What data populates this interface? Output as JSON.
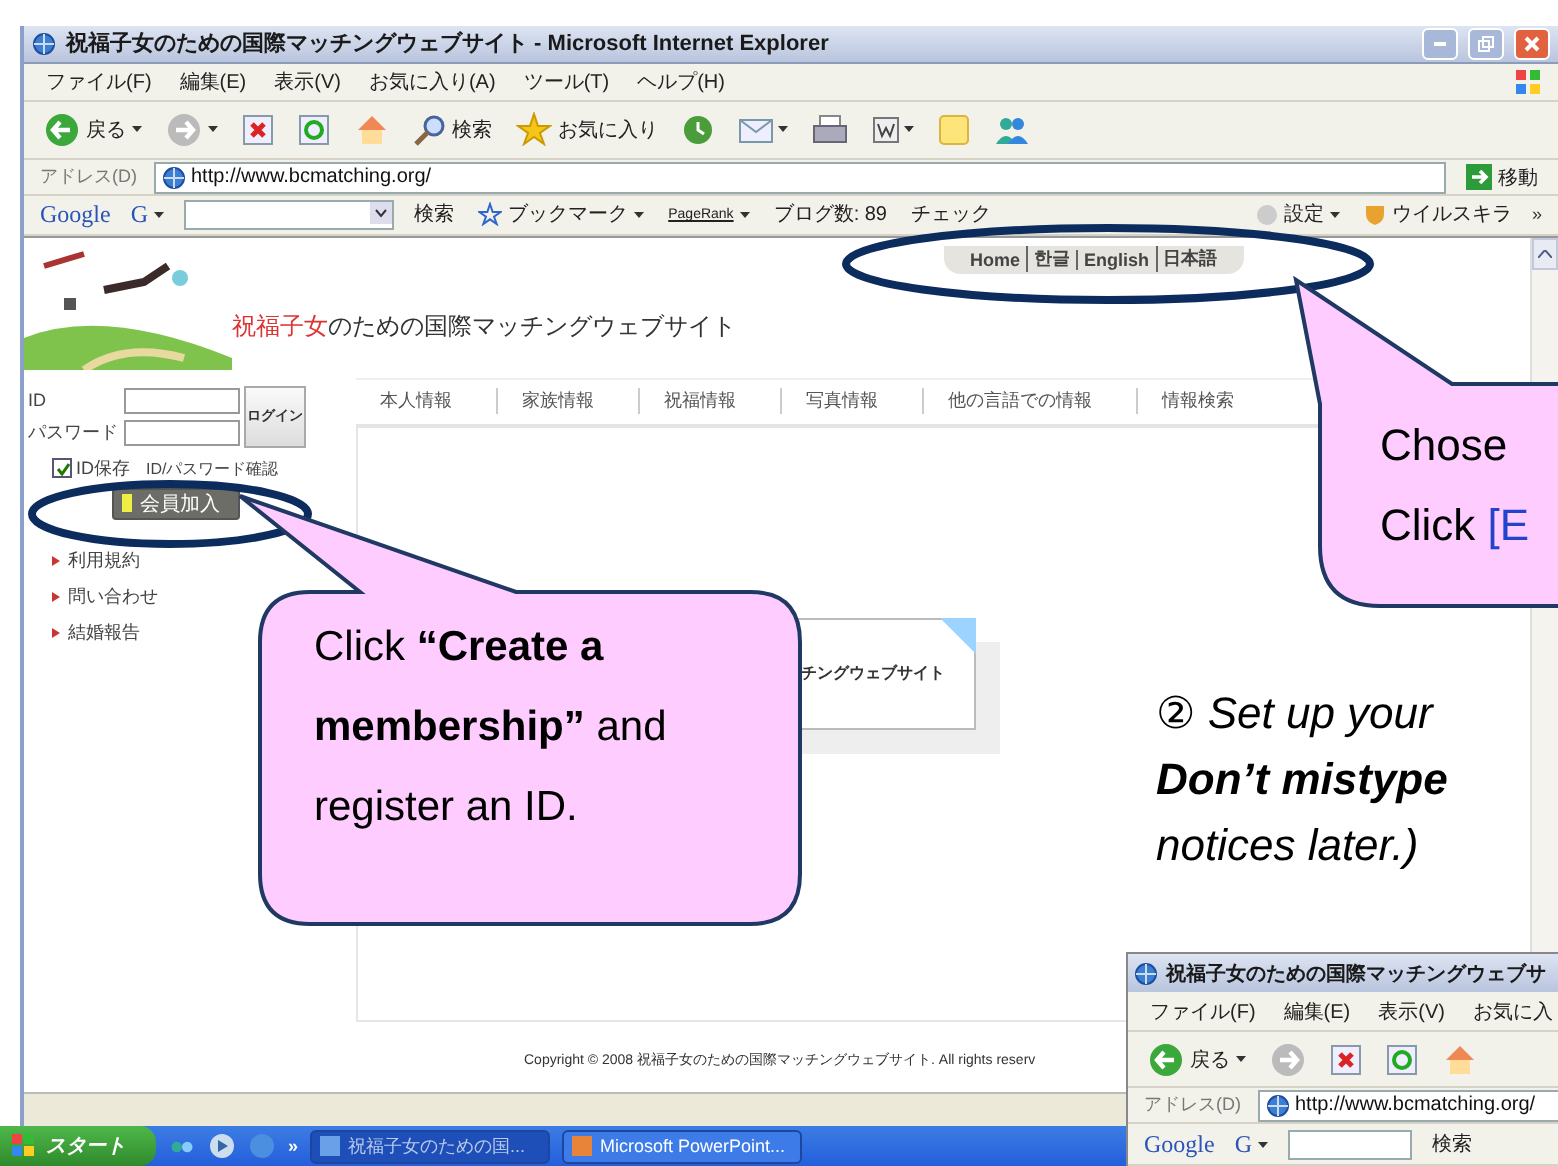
{
  "window": {
    "title": "祝福子女のための国際マッチングウェブサイト - Microsoft Internet Explorer"
  },
  "menu": [
    "ファイル(F)",
    "編集(E)",
    "表示(V)",
    "お気に入り(A)",
    "ツール(T)",
    "ヘルプ(H)"
  ],
  "toolbar": [
    {
      "kind": "back",
      "label": "戻る"
    },
    {
      "kind": "forward"
    },
    {
      "kind": "stop"
    },
    {
      "kind": "refresh"
    },
    {
      "kind": "home"
    },
    {
      "kind": "search",
      "label": "検索"
    },
    {
      "kind": "favorites",
      "label": "お気に入り"
    },
    {
      "kind": "history"
    },
    {
      "kind": "mail"
    },
    {
      "kind": "print"
    },
    {
      "kind": "word"
    },
    {
      "kind": "note"
    },
    {
      "kind": "messenger"
    }
  ],
  "address": {
    "label": "アドレス(D)",
    "url": "http://www.bcmatching.org/",
    "go": "移動"
  },
  "google_bar": {
    "logo": "Google",
    "engine": "G",
    "search": "検索",
    "bookmarks": "ブックマーク",
    "pagerank": "PageRank",
    "blog_count": "ブログ数: 89",
    "check": "チェック",
    "settings": "設定",
    "virus": "ウイルスキラ",
    "more": "»"
  },
  "site": {
    "title_highlight": "祝福子女",
    "title_rest": "のための国際マッチングウェブサイト",
    "lang_links": [
      "Home",
      "한글",
      "English",
      "日本語"
    ],
    "login": {
      "id_label": "ID",
      "password_label": "パスワード",
      "button": "ログイン",
      "remember": {
        "label": "ID保存",
        "checked": true
      },
      "find_link": "ID/パスワード確認",
      "join_button": "会員加入"
    },
    "links": [
      "利用規約",
      "問い合わせ",
      "結婚報告"
    ],
    "nav": [
      "本人情報",
      "家族情報",
      "祝福情報",
      "写真情報",
      "他の言語での情報",
      "情報検索"
    ],
    "card_text": "チングウェブサイト",
    "copyright": "Copyright © 2008 祝福子女のための国際マッチングウェブサイト. All rights reserv"
  },
  "taskbar": {
    "start": "スタート",
    "more": "»",
    "tasks": [
      {
        "label": "祝福子女のための国...",
        "selected": true
      },
      {
        "label": "Microsoft PowerPoint...",
        "selected": false
      }
    ]
  },
  "callout_join": {
    "text": "Click **“Create a membership”** and register an ID."
  },
  "callout_language": {
    "line1": "Chose",
    "line2": "Click",
    "line2_link": "[E"
  },
  "slide_note": [
    {
      "text": "② Set up your",
      "bold": false
    },
    {
      "text": "Don’t mistype",
      "bold": true
    },
    {
      "text": "notices later.)",
      "bold": false
    }
  ],
  "inset": {
    "title": "祝福子女のための国際マッチングウェブサ",
    "menu": [
      "ファイル(F)",
      "編集(E)",
      "表示(V)",
      "お気に入"
    ],
    "back": "戻る",
    "address_label": "アドレス(D)",
    "url": "http://www.bcmatching.org/",
    "google": "Google",
    "engine": "G",
    "search": "検索"
  }
}
